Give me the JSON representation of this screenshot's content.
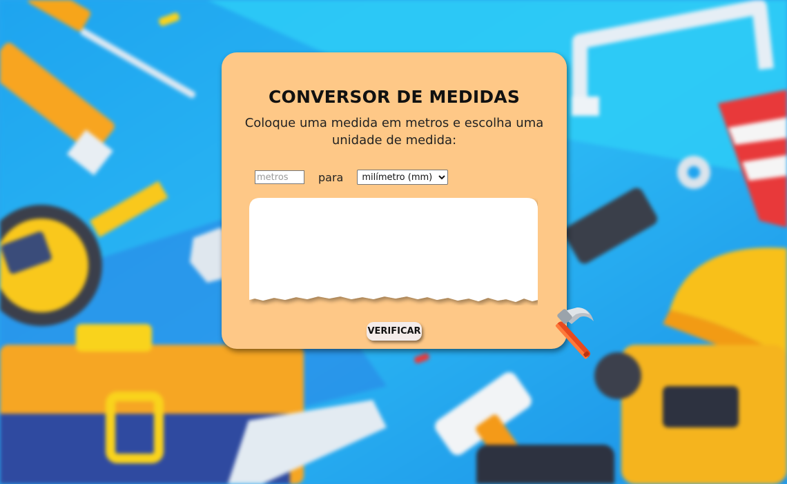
{
  "app": {
    "title": "CONVERSOR DE MEDIDAS",
    "instruction": "Coloque uma medida em metros e escolha uma unidade de medida:"
  },
  "form": {
    "meters_placeholder": "metros",
    "meters_value": "",
    "connector": "para",
    "unit_selected": "milímetro (mm)"
  },
  "result": {
    "text": ""
  },
  "actions": {
    "verify_label": "VERIFICAR"
  },
  "icons": {
    "decoration": "hammer-icon",
    "background": "tools-background-illustration"
  },
  "colors": {
    "card": "#fec887",
    "background": "#2aa6ee",
    "button": "#f4ecea"
  }
}
